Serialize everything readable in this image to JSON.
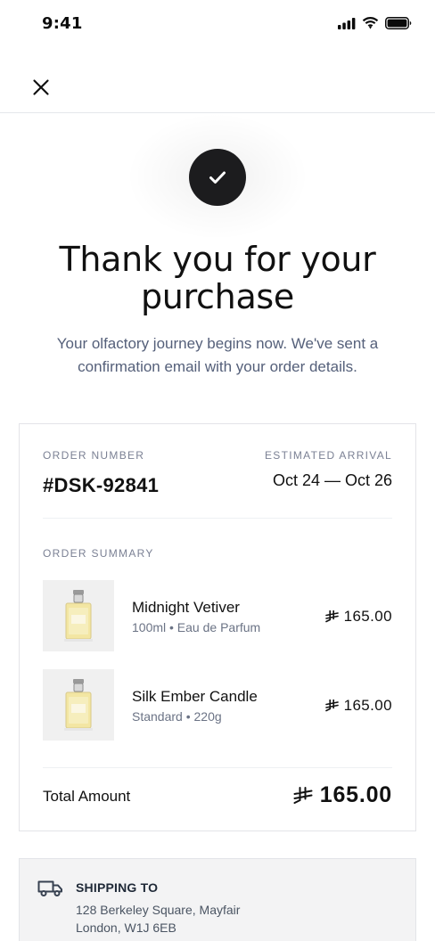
{
  "status_bar": {
    "time": "9:41"
  },
  "top_bar": {
    "close_icon": "close-icon"
  },
  "hero": {
    "icon": "check-icon",
    "title": "Thank you for your purchase",
    "subtitle": "Your olfactory journey begins now. We've sent a confirmation email with your order details."
  },
  "order": {
    "number_label": "ORDER NUMBER",
    "number": "#DSK-92841",
    "arrival_label": "ESTIMATED ARRIVAL",
    "arrival": "Oct 24 — Oct 26",
    "summary_label": "ORDER SUMMARY",
    "currency_icon": "riyal-icon",
    "items": [
      {
        "name": "Midnight Vetiver",
        "meta": "100ml • Eau de Parfum",
        "price": "165.00",
        "image": "perfume-bottle-icon"
      },
      {
        "name": "Silk Ember Candle",
        "meta": "Standard • 220g",
        "price": "165.00",
        "image": "perfume-bottle-icon"
      }
    ],
    "total_label": "Total Amount",
    "total": "165.00"
  },
  "shipping": {
    "icon": "truck-icon",
    "title": "SHIPPING TO",
    "line1": "128 Berkeley Square, Mayfair",
    "line2": "London, W1J 6EB"
  }
}
